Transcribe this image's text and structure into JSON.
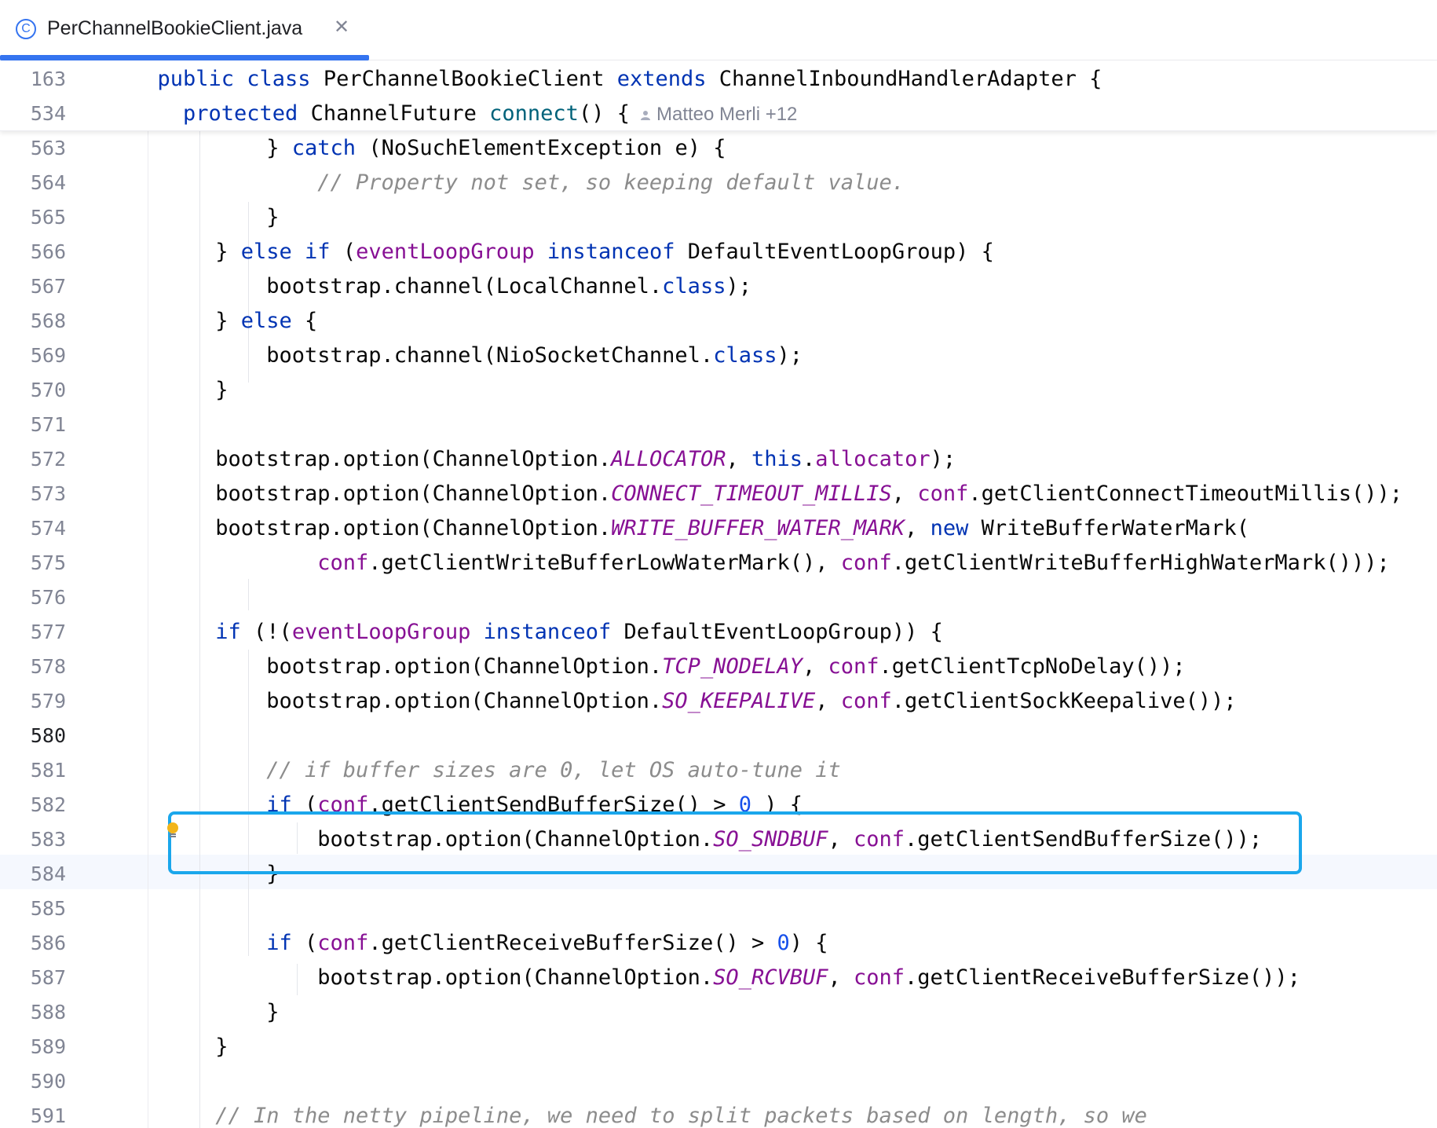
{
  "tab": {
    "icon": "class-icon",
    "icon_glyph": "C",
    "title": "PerChannelBookieClient.java",
    "close_glyph": "✕"
  },
  "sticky": [
    {
      "ln": "163",
      "tokens": [
        [
          "kw",
          "public class "
        ],
        [
          "",
          "PerChannelBookieClient "
        ],
        [
          "kw",
          "extends "
        ],
        [
          "",
          "ChannelInboundHandlerAdapter {"
        ]
      ]
    },
    {
      "ln": "534",
      "tokens": [
        [
          "kw",
          "protected "
        ],
        [
          "",
          "ChannelFuture "
        ],
        [
          "fn",
          "connect"
        ],
        [
          "",
          "() {"
        ]
      ],
      "author": "Matteo Merli +12"
    }
  ],
  "lines": [
    {
      "ln": "563",
      "indent": 3,
      "tokens": [
        [
          "",
          "} "
        ],
        [
          "kw",
          "catch "
        ],
        [
          "",
          "(NoSuchElementException e) {"
        ]
      ]
    },
    {
      "ln": "564",
      "indent": 4,
      "tokens": [
        [
          "cm",
          "// Property not set, so keeping default value."
        ]
      ]
    },
    {
      "ln": "565",
      "indent": 3,
      "tokens": [
        [
          "",
          "}"
        ]
      ]
    },
    {
      "ln": "566",
      "indent": 2,
      "tokens": [
        [
          "",
          "} "
        ],
        [
          "kw",
          "else if "
        ],
        [
          "",
          "("
        ],
        [
          "fld",
          "eventLoopGroup "
        ],
        [
          "kw",
          "instanceof "
        ],
        [
          "",
          "DefaultEventLoopGroup) {"
        ]
      ]
    },
    {
      "ln": "567",
      "indent": 3,
      "tokens": [
        [
          "",
          "bootstrap.channel(LocalChannel."
        ],
        [
          "kw",
          "class"
        ],
        [
          "",
          ");"
        ]
      ]
    },
    {
      "ln": "568",
      "indent": 2,
      "tokens": [
        [
          "",
          "} "
        ],
        [
          "kw",
          "else "
        ],
        [
          "",
          "{"
        ]
      ]
    },
    {
      "ln": "569",
      "indent": 3,
      "tokens": [
        [
          "",
          "bootstrap.channel(NioSocketChannel."
        ],
        [
          "kw",
          "class"
        ],
        [
          "",
          ");"
        ]
      ]
    },
    {
      "ln": "570",
      "indent": 2,
      "tokens": [
        [
          "",
          "}"
        ]
      ]
    },
    {
      "ln": "571",
      "indent": 0,
      "tokens": []
    },
    {
      "ln": "572",
      "indent": 2,
      "tokens": [
        [
          "",
          "bootstrap.option(ChannelOption."
        ],
        [
          "sf",
          "ALLOCATOR"
        ],
        [
          "",
          ", "
        ],
        [
          "kw",
          "this"
        ],
        [
          "",
          "."
        ],
        [
          "fld",
          "allocator"
        ],
        [
          "",
          ");"
        ]
      ]
    },
    {
      "ln": "573",
      "indent": 2,
      "tokens": [
        [
          "",
          "bootstrap.option(ChannelOption."
        ],
        [
          "sf",
          "CONNECT_TIMEOUT_MILLIS"
        ],
        [
          "",
          ", "
        ],
        [
          "fld",
          "conf"
        ],
        [
          "",
          ".getClientConnectTimeoutMillis());"
        ]
      ]
    },
    {
      "ln": "574",
      "indent": 2,
      "tokens": [
        [
          "",
          "bootstrap.option(ChannelOption."
        ],
        [
          "sf",
          "WRITE_BUFFER_WATER_MARK"
        ],
        [
          "",
          ", "
        ],
        [
          "kw",
          "new "
        ],
        [
          "",
          "WriteBufferWaterMark("
        ]
      ]
    },
    {
      "ln": "575",
      "indent": 4,
      "tokens": [
        [
          "fld",
          "conf"
        ],
        [
          "",
          ".getClientWriteBufferLowWaterMark(), "
        ],
        [
          "fld",
          "conf"
        ],
        [
          "",
          ".getClientWriteBufferHighWaterMark()));"
        ]
      ]
    },
    {
      "ln": "576",
      "indent": 0,
      "tokens": []
    },
    {
      "ln": "577",
      "indent": 2,
      "tokens": [
        [
          "kw",
          "if "
        ],
        [
          "",
          "(!("
        ],
        [
          "fld",
          "eventLoopGroup "
        ],
        [
          "kw",
          "instanceof "
        ],
        [
          "",
          "DefaultEventLoopGroup)) {"
        ]
      ]
    },
    {
      "ln": "578",
      "indent": 3,
      "tokens": [
        [
          "",
          "bootstrap.option(ChannelOption."
        ],
        [
          "sf",
          "TCP_NODELAY"
        ],
        [
          "",
          ", "
        ],
        [
          "fld",
          "conf"
        ],
        [
          "",
          ".getClientTcpNoDelay());"
        ]
      ]
    },
    {
      "ln": "579",
      "indent": 3,
      "tokens": [
        [
          "",
          "bootstrap.option(ChannelOption."
        ],
        [
          "sf",
          "SO_KEEPALIVE"
        ],
        [
          "",
          ", "
        ],
        [
          "fld",
          "conf"
        ],
        [
          "",
          ".getClientSockKeepalive());"
        ]
      ]
    },
    {
      "ln": "580",
      "indent": 0,
      "tokens": []
    },
    {
      "ln": "581",
      "indent": 3,
      "tokens": [
        [
          "cm",
          "// if buffer sizes are 0, let OS auto-tune it"
        ]
      ]
    },
    {
      "ln": "582",
      "indent": 3,
      "tokens": [
        [
          "kw",
          "if "
        ],
        [
          "",
          "("
        ],
        [
          "fld",
          "conf"
        ],
        [
          "",
          ".getClientSendBufferSize() > "
        ],
        [
          "num",
          "0"
        ],
        [
          "",
          " ) {"
        ]
      ]
    },
    {
      "ln": "583",
      "indent": 4,
      "tokens": [
        [
          "",
          "bootstrap.option(ChannelOption."
        ],
        [
          "sf",
          "SO_SNDBUF"
        ],
        [
          "",
          ", "
        ],
        [
          "fld",
          "conf"
        ],
        [
          "",
          ".getClientSendBufferSize());"
        ]
      ]
    },
    {
      "ln": "584",
      "indent": 3,
      "tokens": [
        [
          "",
          "}"
        ]
      ]
    },
    {
      "ln": "585",
      "indent": 0,
      "tokens": []
    },
    {
      "ln": "586",
      "indent": 3,
      "tokens": [
        [
          "kw",
          "if "
        ],
        [
          "",
          "("
        ],
        [
          "fld",
          "conf"
        ],
        [
          "",
          ".getClientReceiveBufferSize() > "
        ],
        [
          "num",
          "0"
        ],
        [
          "",
          ") {"
        ]
      ]
    },
    {
      "ln": "587",
      "indent": 4,
      "tokens": [
        [
          "",
          "bootstrap.option(ChannelOption."
        ],
        [
          "sf",
          "SO_RCVBUF"
        ],
        [
          "",
          ", "
        ],
        [
          "fld",
          "conf"
        ],
        [
          "",
          ".getClientReceiveBufferSize());"
        ]
      ]
    },
    {
      "ln": "588",
      "indent": 3,
      "tokens": [
        [
          "",
          "}"
        ]
      ]
    },
    {
      "ln": "589",
      "indent": 2,
      "tokens": [
        [
          "",
          "}"
        ]
      ]
    },
    {
      "ln": "590",
      "indent": 0,
      "tokens": []
    },
    {
      "ln": "591",
      "indent": 2,
      "tokens": [
        [
          "cm",
          "// In the netty pipeline, we need to split packets based on length, so we"
        ]
      ]
    }
  ],
  "current_line": "580",
  "highlighted_lines": [
    "579",
    "580"
  ],
  "colors": {
    "keyword": "#0033b3",
    "field": "#871094",
    "comment": "#8c8c8c",
    "number": "#1750eb",
    "method_decl": "#00627a",
    "highlight_box": "#1aa7ec",
    "tab_accent": "#3574f0"
  }
}
